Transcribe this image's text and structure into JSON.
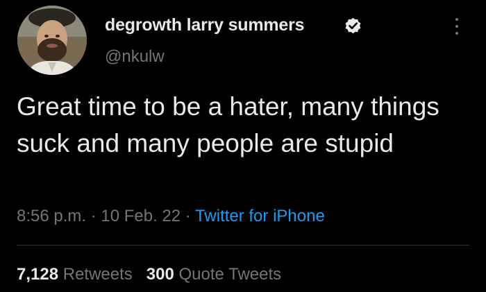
{
  "author": {
    "display_name": "degrowth larry summers",
    "handle": "@nkulw",
    "verified": true
  },
  "tweet": {
    "text": "Great time to be a hater, many things suck and many people are stupid",
    "time": "8:56 p.m.",
    "separator": " · ",
    "date": "10 Feb. 22",
    "source": "Twitter for iPhone"
  },
  "stats": {
    "retweets_count": "7,128",
    "retweets_label": "Retweets",
    "quote_tweets_count": "300",
    "quote_tweets_label": "Quote Tweets"
  },
  "icons": {
    "verified": "verified-badge-icon",
    "more": "more-options-icon"
  },
  "colors": {
    "background": "#000000",
    "text": "#e7e9ea",
    "secondary_text": "#71767b",
    "accent": "#1d9bf0",
    "divider": "#2f3336"
  }
}
